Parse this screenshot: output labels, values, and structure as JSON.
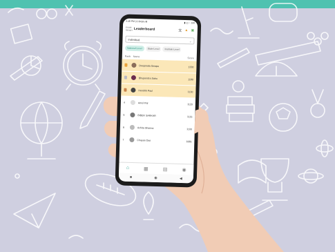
{
  "status": {
    "time": "4:48 PM | 0.3KB/s ⊠",
    "right": "▮ ◫ ◔ 100"
  },
  "header": {
    "back": "EXAM READY",
    "title": "Leaderboard"
  },
  "filter": {
    "selected": "Individual"
  },
  "tabs": [
    {
      "label": "National Level",
      "active": true
    },
    {
      "label": "State Level",
      "active": false
    },
    {
      "label": "Institute Level",
      "active": false
    }
  ],
  "columns": {
    "rank": "Rank",
    "name": "Name",
    "score": "Score"
  },
  "rows": [
    {
      "rank": "1",
      "name": "Deepmala Swapa",
      "score": "1330",
      "top": true,
      "avatar": "#8a6d5a"
    },
    {
      "rank": "2",
      "name": "Bhupendra Sahu",
      "score": "1180",
      "top": true,
      "avatar": "#6a2c4e"
    },
    {
      "rank": "3",
      "name": "Hendrik Paul",
      "score": "1130",
      "top": true,
      "avatar": "#444"
    },
    {
      "rank": "4",
      "name": "Amol Pal",
      "score": "1120",
      "top": false,
      "avatar": "#ddd"
    },
    {
      "rank": "5",
      "name": "BIBEK SARKAR",
      "score": "1115",
      "top": false,
      "avatar": "#777"
    },
    {
      "rank": "6",
      "name": "Achita Sharma",
      "score": "1100",
      "top": false,
      "avatar": "#bbb"
    },
    {
      "rank": "7",
      "name": "Chayan Das",
      "score": "1085",
      "top": false,
      "avatar": "#999"
    }
  ],
  "colors": {
    "accent": "#4fc2b0",
    "highlight": "#fbe7b8",
    "background": "#cfcfe0"
  }
}
